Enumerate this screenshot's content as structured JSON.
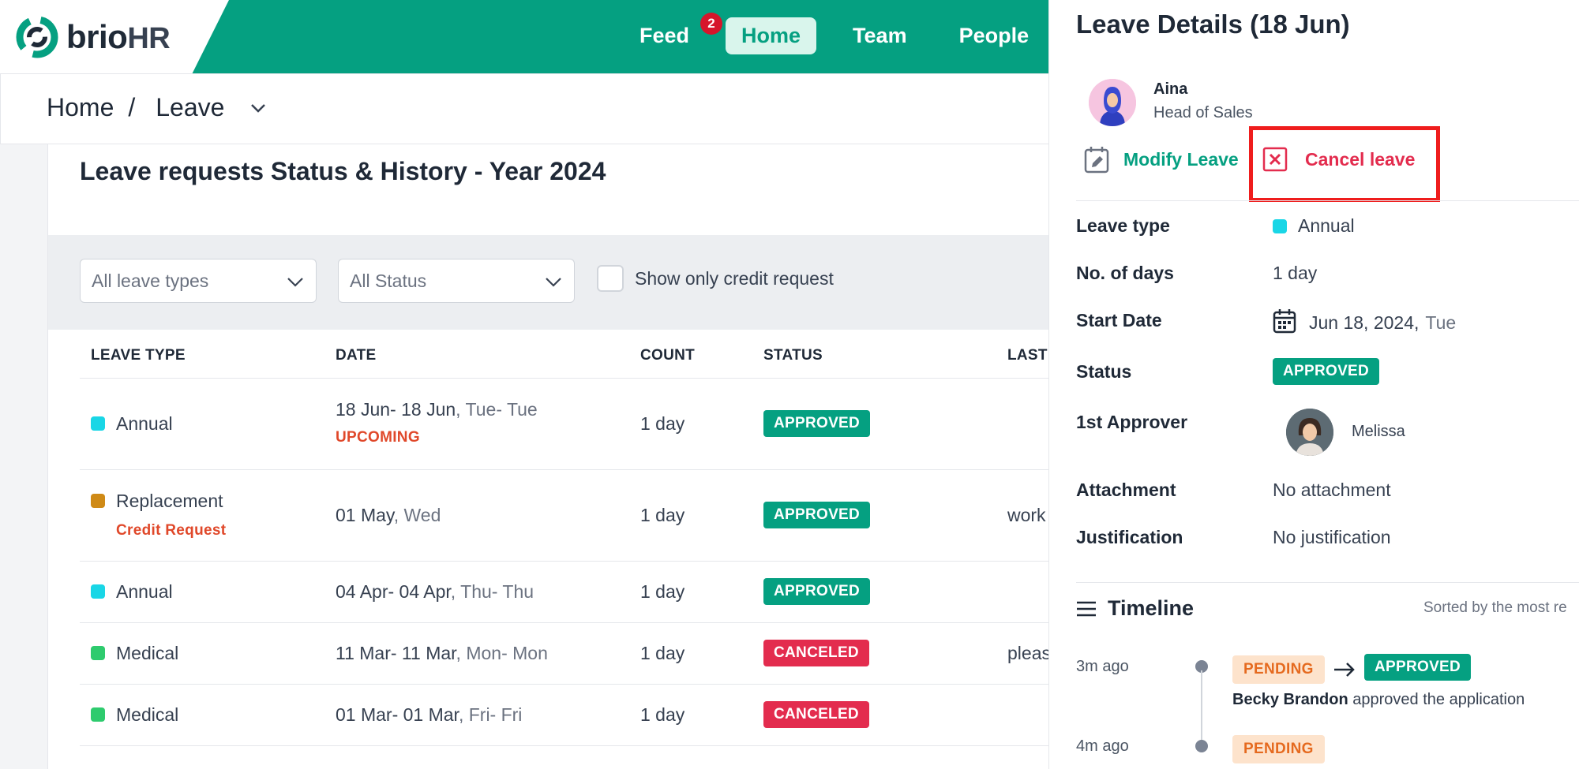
{
  "brand": {
    "name": "brio",
    "suffix": "HR"
  },
  "nav": {
    "items": [
      {
        "label": "Feed",
        "badge": "2"
      },
      {
        "label": "Home"
      },
      {
        "label": "Team"
      },
      {
        "label": "People"
      }
    ]
  },
  "breadcrumb": {
    "home": "Home",
    "separator": "/",
    "current": "Leave"
  },
  "main": {
    "title": "Leave requests Status & History - Year 2024",
    "filters": {
      "leave_types": "All leave types",
      "status": "All Status",
      "credit_label": "Show only credit request"
    },
    "columns": [
      "LEAVE TYPE",
      "DATE",
      "COUNT",
      "STATUS",
      "LAST"
    ],
    "rows": [
      {
        "type": "Annual",
        "type_color": "#19d6e6",
        "sub": "",
        "date": "18 Jun- 18 Jun",
        "days": ", Tue- Tue",
        "date_sub": "UPCOMING",
        "count": "1 day",
        "status": "APPROVED",
        "last": ""
      },
      {
        "type": "Replacement",
        "type_color": "#cf8a16",
        "sub": "Credit Request",
        "date": "01 May",
        "days": ", Wed",
        "date_sub": "",
        "count": "1 day",
        "status": "APPROVED",
        "last": "work"
      },
      {
        "type": "Annual",
        "type_color": "#19d6e6",
        "sub": "",
        "date": "04 Apr- 04 Apr",
        "days": ", Thu- Thu",
        "date_sub": "",
        "count": "1 day",
        "status": "APPROVED",
        "last": ""
      },
      {
        "type": "Medical",
        "type_color": "#2ecb6e",
        "sub": "",
        "date": "11 Mar- 11 Mar",
        "days": ", Mon- Mon",
        "date_sub": "",
        "count": "1 day",
        "status": "CANCELED",
        "last": "pleas"
      },
      {
        "type": "Medical",
        "type_color": "#2ecb6e",
        "sub": "",
        "date": "01 Mar- 01 Mar",
        "days": ", Fri- Fri",
        "date_sub": "",
        "count": "1 day",
        "status": "CANCELED",
        "last": ""
      }
    ]
  },
  "panel": {
    "title": "Leave Details (18 Jun)",
    "user": {
      "name": "Aina",
      "role": "Head of Sales"
    },
    "actions": {
      "modify": "Modify Leave",
      "cancel": "Cancel leave"
    },
    "details": {
      "leave_type_label": "Leave type",
      "leave_type": "Annual",
      "leave_color": "#19d6e6",
      "days_label": "No. of days",
      "days": "1 day",
      "start_label": "Start Date",
      "start_date": "Jun 18, 2024,",
      "start_day": "Tue",
      "status_label": "Status",
      "status": "APPROVED",
      "approver_label": "1st Approver",
      "approver": "Melissa",
      "attachment_label": "Attachment",
      "attachment": "No attachment",
      "justification_label": "Justification",
      "justification": "No justification"
    },
    "timeline": {
      "title": "Timeline",
      "sorted": "Sorted by the most re",
      "entries": [
        {
          "time": "3m ago",
          "from": "PENDING",
          "to": "APPROVED",
          "actor": "Becky Brandon",
          "text": "approved the application"
        },
        {
          "time": "4m ago",
          "from": "PENDING"
        }
      ]
    }
  },
  "colors": {
    "brand_green": "#05a081",
    "danger_red": "#e32c4e",
    "highlight_red": "#ef1d1d"
  }
}
